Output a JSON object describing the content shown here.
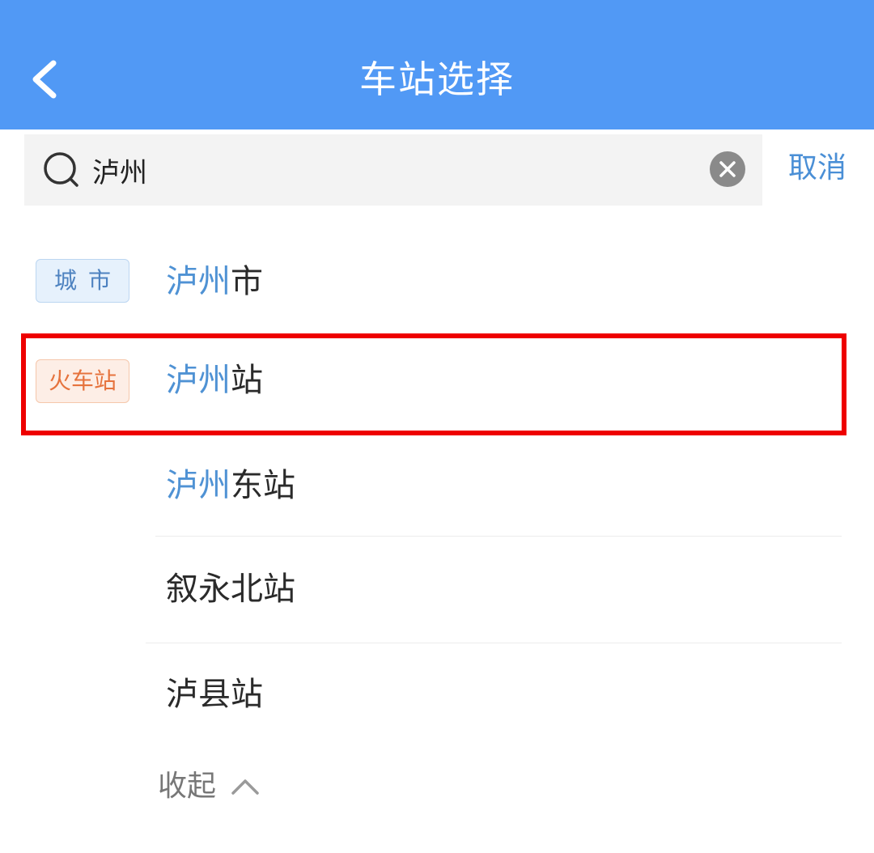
{
  "header": {
    "title": "车站选择",
    "back_icon": "chevron-left-icon",
    "background": "#5199f5"
  },
  "search": {
    "value": "泸州",
    "search_icon": "search-icon",
    "clear_icon": "clear-icon",
    "cancel_label": "取消"
  },
  "tags": {
    "city": "城市",
    "train_station": "火车站"
  },
  "results": [
    {
      "match": "泸州",
      "rest": "市",
      "type": "city"
    },
    {
      "match": "泸州",
      "rest": "站",
      "type": "train_station",
      "highlighted": true
    },
    {
      "match": "泸州",
      "rest": "东站",
      "type": "train_station"
    },
    {
      "match": "",
      "rest": "叙永北站",
      "type": "train_station"
    },
    {
      "match": "",
      "rest": "泸县站",
      "type": "train_station"
    }
  ],
  "collapse": {
    "label": "收起",
    "icon": "chevron-up-icon"
  },
  "colors": {
    "accent": "#4f92d4",
    "highlight_border": "#ee0000",
    "train_tag": "#e6733d",
    "city_tag": "#4d82c0"
  }
}
